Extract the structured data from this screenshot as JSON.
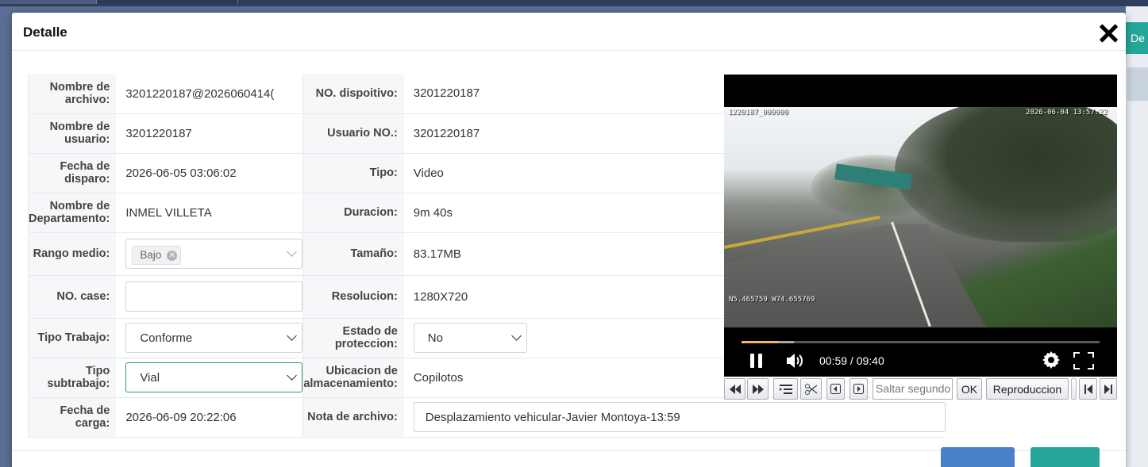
{
  "background": {
    "right_button_label": "De"
  },
  "modal": {
    "title": "Detalle",
    "fields": {
      "file_name_label": "Nombre de archivo:",
      "file_name_value": "3201220187@2026060414(",
      "device_no_label": "NO. dispoitivo:",
      "device_no_value": "3201220187",
      "user_name_label": "Nombre de usuario:",
      "user_name_value": "3201220187",
      "user_no_label": "Usuario NO.:",
      "user_no_value": "3201220187",
      "trigger_date_label": "Fecha de disparo:",
      "trigger_date_value": "2026-06-05 03:06:02",
      "type_label": "Tipo:",
      "type_value": "Video",
      "department_label": "Nombre de Departamento:",
      "department_value": "INMEL VILLETA",
      "duration_label": "Duracion:",
      "duration_value": "9m 40s",
      "media_range_label": "Rango medio:",
      "media_range_tag": "Bajo",
      "size_label": "Tamaño:",
      "size_value": "83.17MB",
      "case_no_label": "NO. case:",
      "case_no_value": "",
      "resolution_label": "Resolucion:",
      "resolution_value": "1280X720",
      "work_type_label": "Tipo Trabajo:",
      "work_type_value": "Conforme",
      "protection_label": "Estado de proteccion:",
      "protection_value": "No",
      "subwork_type_label": "Tipo subtrabajo:",
      "subwork_type_value": "Vial",
      "storage_label": "Ubicacion de almacenamiento:",
      "storage_value": "Copilotos",
      "upload_date_label": "Fecha de carga:",
      "upload_date_value": "2026-06-09 20:22:06",
      "file_note_label": "Nota de archivo:",
      "file_note_value": "Desplazamiento vehicular-Javier Montoya-13:59"
    }
  },
  "video": {
    "osd_top_left": "1220187_000000",
    "osd_top_right": "2026-06-04 13:57:22",
    "osd_bottom_left": "N5.465759 W74.655769",
    "time_display": "00:59 / 09:40",
    "progress_fraction": 0.102,
    "buffered_fraction": 0.146
  },
  "toolbar": {
    "skip_placeholder": "Saltar segundo",
    "ok_label": "OK",
    "playback_label": "Reproduccion"
  }
}
